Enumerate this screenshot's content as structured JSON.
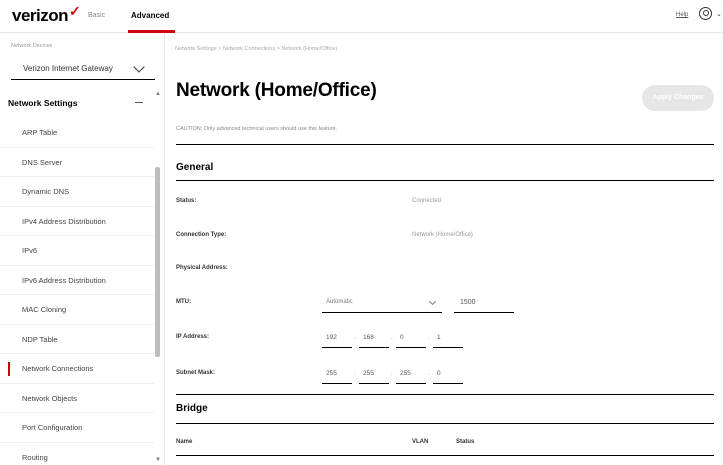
{
  "header": {
    "logo": "verizon",
    "nav": {
      "basic": "Basic",
      "advanced": "Advanced"
    },
    "help": "Help"
  },
  "sidebar": {
    "device_label": "Network Devices",
    "device_selected": "Verizon Internet Gateway",
    "section_title": "Network Settings",
    "items": [
      {
        "label": "ARP Table",
        "active": false
      },
      {
        "label": "DNS Server",
        "active": false
      },
      {
        "label": "Dynamic DNS",
        "active": false
      },
      {
        "label": "IPv4 Address Distribution",
        "active": false
      },
      {
        "label": "IPv6",
        "active": false
      },
      {
        "label": "IPv6 Address Distribution",
        "active": false
      },
      {
        "label": "MAC Cloning",
        "active": false
      },
      {
        "label": "NDP Table",
        "active": false
      },
      {
        "label": "Network Connections",
        "active": true
      },
      {
        "label": "Network Objects",
        "active": false
      },
      {
        "label": "Port Configuration",
        "active": false
      },
      {
        "label": "Routing",
        "active": false
      }
    ]
  },
  "main": {
    "breadcrumb": "Network Settings  >  Network Connections  >  Network (Home/Office)",
    "title": "Network (Home/Office)",
    "apply_label": "Apply Changes",
    "warning": "CAUTION: Only advanced technical users should use this feature.",
    "general": {
      "title": "General",
      "status_label": "Status:",
      "status_value": "Connected",
      "conn_type_label": "Connection Type:",
      "conn_type_value": "Network (Home/Office)",
      "phys_addr_label": "Physical Address:",
      "mtu_label": "MTU:",
      "mtu_mode": "Automatic",
      "mtu_value": "1500",
      "ip_label": "IP Address:",
      "ip": [
        "192",
        "168",
        "0",
        "1"
      ],
      "subnet_label": "Subnet Mask:",
      "subnet": [
        "255",
        "255",
        "255",
        "0"
      ]
    },
    "bridge": {
      "title": "Bridge",
      "col_name": "Name",
      "col_vlan": "VLAN",
      "col_status": "Status"
    }
  }
}
